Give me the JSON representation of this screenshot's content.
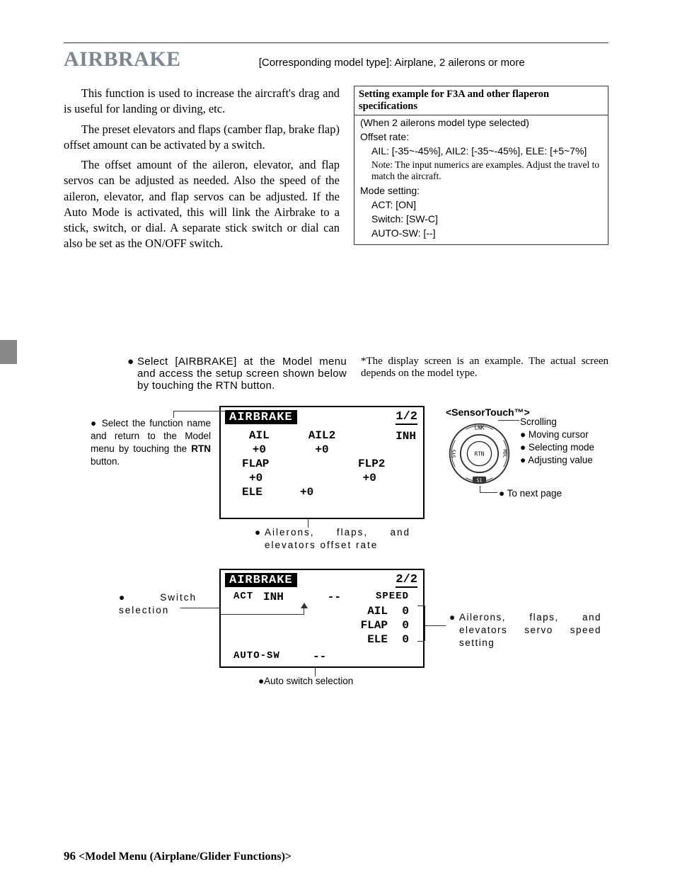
{
  "header": {
    "title": "AIRBRAKE",
    "subtitle": "[Corresponding model type]: Airplane, 2 ailerons or more"
  },
  "body": {
    "p1": "This function is used to increase the aircraft's drag and is useful for landing or diving, etc.",
    "p2": "The preset elevators and flaps (camber flap, brake flap) offset amount can be activated by a switch.",
    "p3": "The offset amount of the aileron, elevator, and flap servos can be adjusted as needed. Also the speed of the aileron, elevator, and flap servos can be adjusted. If the Auto Mode is activated, this will link the Airbrake to a stick, switch, or dial. A separate stick switch or dial can also be set as the ON/OFF switch."
  },
  "example": {
    "header": "Setting example for F3A and other flaperon specifications",
    "when": "(When 2 ailerons model type selected)",
    "offset_label": "Offset rate:",
    "offset_values": "AIL: [-35~-45%], AIL2: [-35~-45%], ELE: [+5~7%]",
    "note": "Note: The input numerics are examples. Adjust the travel to match the aircraft.",
    "mode_label": "Mode setting:",
    "act": "ACT: [ON]",
    "switch": "Switch: [SW-C]",
    "auto": "AUTO-SW: [--]"
  },
  "mid": {
    "instruction": "Select [AIRBRAKE] at the Model menu and access the setup screen shown below by touching the RTN button.",
    "disclaimer": "*The display screen is an example. The actual screen depends on the model type."
  },
  "lcd1": {
    "title": "AIRBRAKE",
    "page": "1/2",
    "status": "INH",
    "r1c1": "AIL",
    "r1c2": "AIL2",
    "r2c1": "+0",
    "r2c2": "+0",
    "r3c1": "FLAP",
    "r3c2": "FLP2",
    "r4c1": "+0",
    "r4c2": "+0",
    "r5c1": "ELE",
    "r5c2": "+0"
  },
  "lcd2": {
    "title": "AIRBRAKE",
    "page": "2/2",
    "act_label": "ACT",
    "act_val": "INH",
    "act_dash": "--",
    "speed_label": "SPEED",
    "ail": "AIL",
    "ail_v": "0",
    "flap": "FLAP",
    "flap_v": "0",
    "ele": "ELE",
    "ele_v": "0",
    "auto_label": "AUTO-SW",
    "auto_val": "--"
  },
  "callouts": {
    "l1": "Select the function name and return to the Model menu by touching the",
    "l1b": "RTN",
    "l1c": " button.",
    "sensor_title": "<SensorTouch™>",
    "scrolling": "Scrolling",
    "s1": "Moving cursor",
    "s2": "Selecting mode",
    "s3": "Adjusting value",
    "next": "To next page",
    "below1": "Ailerons, flaps, and elevators offset rate",
    "l2": "Switch selection",
    "r2": "Ailerons, flaps, and elevators servo speed setting",
    "below2": "Auto switch selection"
  },
  "dial": {
    "lnk": "LNK",
    "sys": "SYS",
    "mdl": "MDL",
    "rtn": "RTN",
    "s1": "S1"
  },
  "footer": {
    "page": "96",
    "text": "<Model Menu (Airplane/Glider Functions)>"
  }
}
